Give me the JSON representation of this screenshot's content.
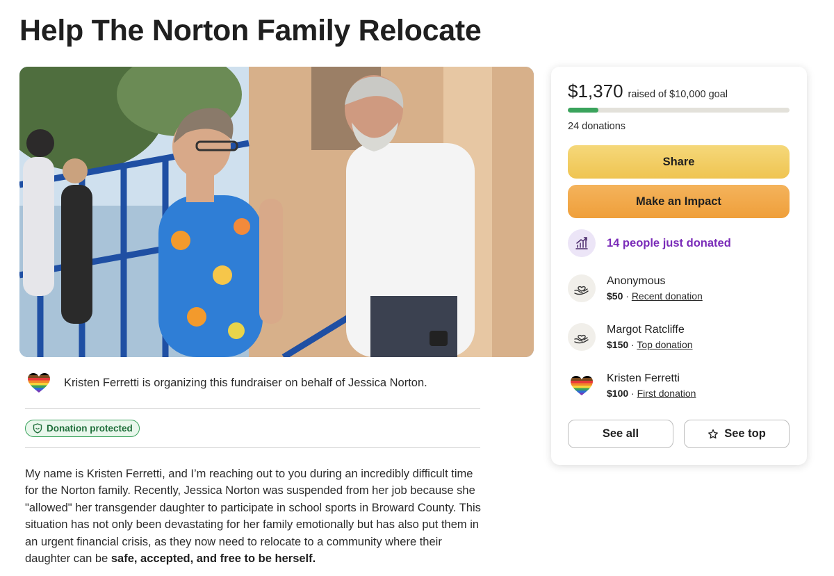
{
  "page": {
    "title": "Help The Norton Family Relocate"
  },
  "organizer": {
    "text": "Kristen Ferretti is organizing this fundraiser on behalf of Jessica Norton.",
    "icon": "pride-heart-icon"
  },
  "badge": {
    "label": "Donation protected",
    "icon": "shield-icon"
  },
  "story": {
    "text": "My name is Kristen Ferretti, and I’m reaching out to you during an incredibly difficult time for the Norton family. Recently, Jessica Norton was suspended from her job because she \"allowed\" her transgender daughter to participate in school sports in Broward County. This situation has not only been devastating for her family emotionally but has also put them in an urgent financial crisis, as they now need to relocate to a community where their daughter can be ",
    "emphasis": "safe, accepted, and free to be herself."
  },
  "donation": {
    "raised": "$1,370",
    "goal_text": "raised of $10,000 goal",
    "progress_fraction": 0.137,
    "count_text": "24 donations",
    "share_label": "Share",
    "impact_label": "Make an Impact",
    "trend_label": "14 people just donated",
    "donors": [
      {
        "name": "Anonymous",
        "amount": "$50",
        "tag": "Recent donation",
        "icon": "heart-hands-icon"
      },
      {
        "name": "Margot Ratcliffe",
        "amount": "$150",
        "tag": "Top donation",
        "icon": "heart-hands-icon"
      },
      {
        "name": "Kristen Ferretti",
        "amount": "$100",
        "tag": "First donation",
        "icon": "pride-heart-icon"
      }
    ],
    "see_all_label": "See all",
    "see_top_label": "See top"
  },
  "colors": {
    "accent_green": "#3aa35c",
    "share_yellow": "#f2cd63",
    "impact_orange": "#f1a847",
    "trend_purple": "#7a2bb8"
  }
}
